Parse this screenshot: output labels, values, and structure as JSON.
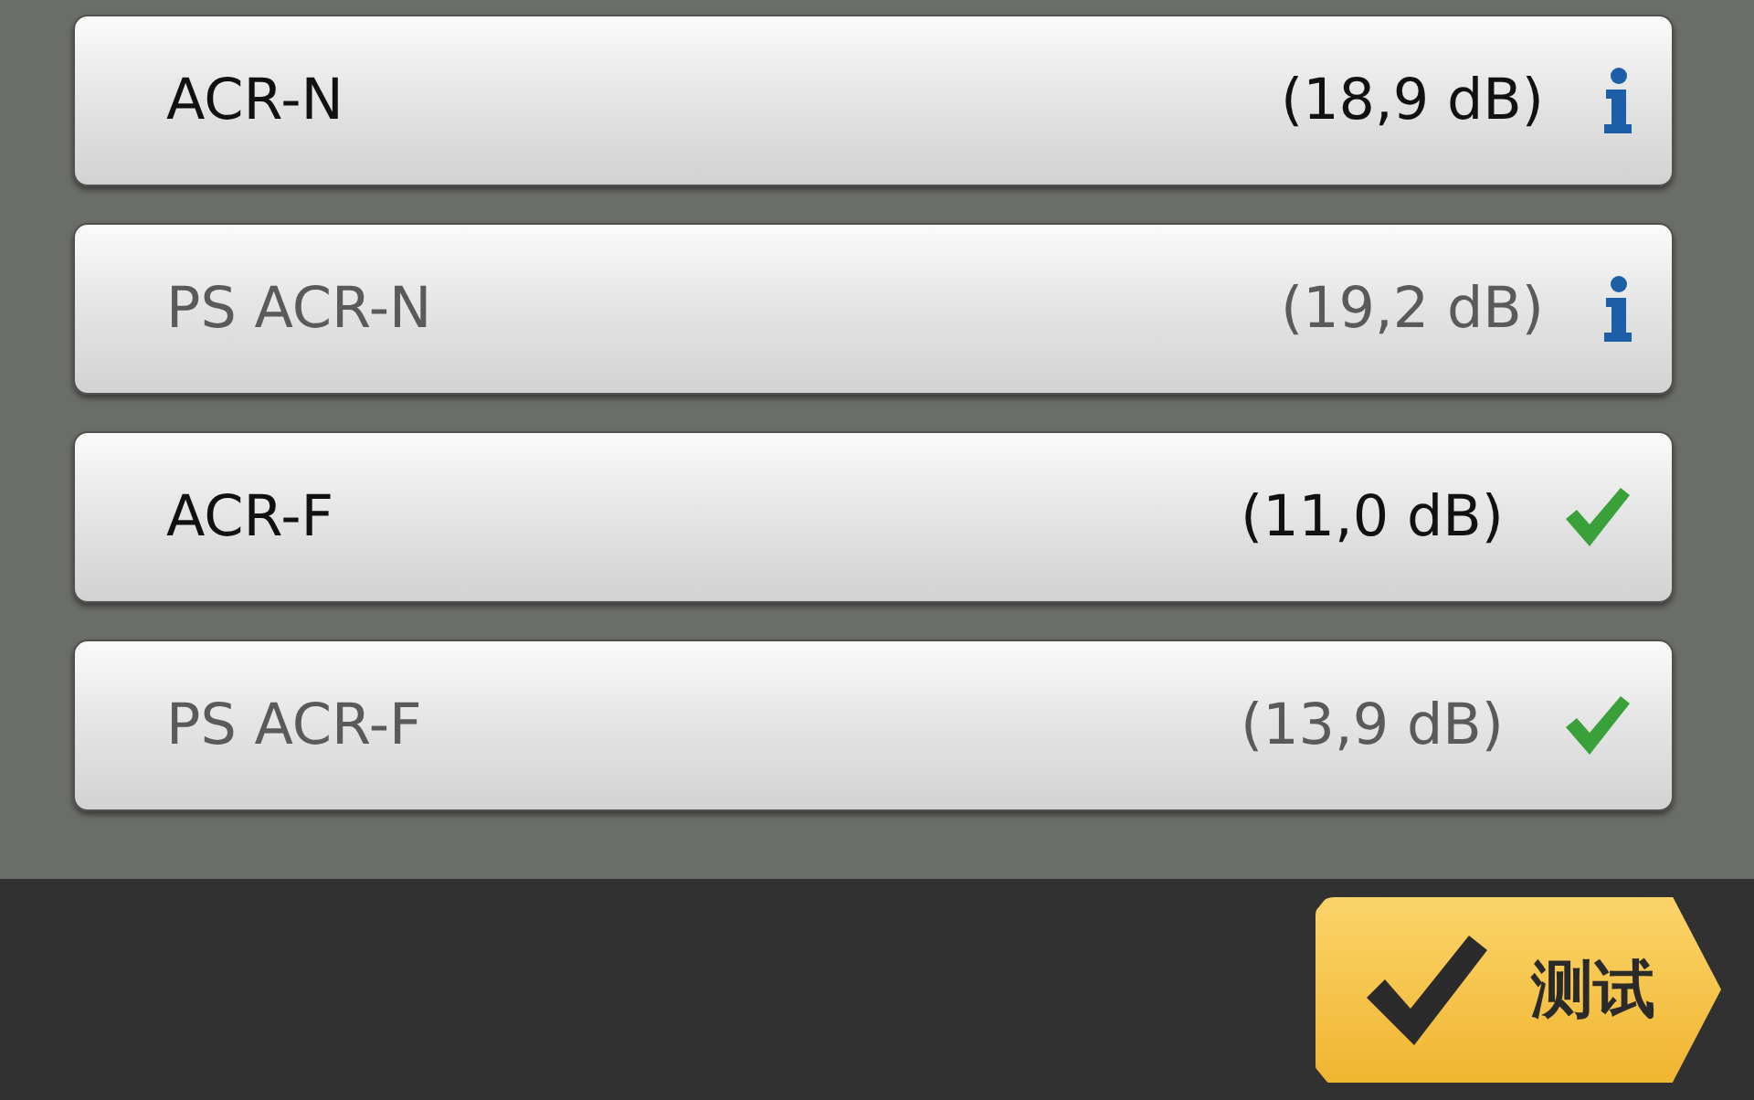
{
  "results": [
    {
      "label": "ACR-N",
      "reading": "(18,9 dB)",
      "dimmed": false,
      "kind": "info"
    },
    {
      "label": "PS ACR-N",
      "reading": "(19,2 dB)",
      "dimmed": true,
      "kind": "info"
    },
    {
      "label": "ACR-F",
      "reading": "(11,0 dB)",
      "dimmed": false,
      "kind": "pass"
    },
    {
      "label": "PS ACR-F",
      "reading": "(13,9 dB)",
      "dimmed": true,
      "kind": "pass"
    }
  ],
  "test_button": {
    "label": "测试"
  }
}
